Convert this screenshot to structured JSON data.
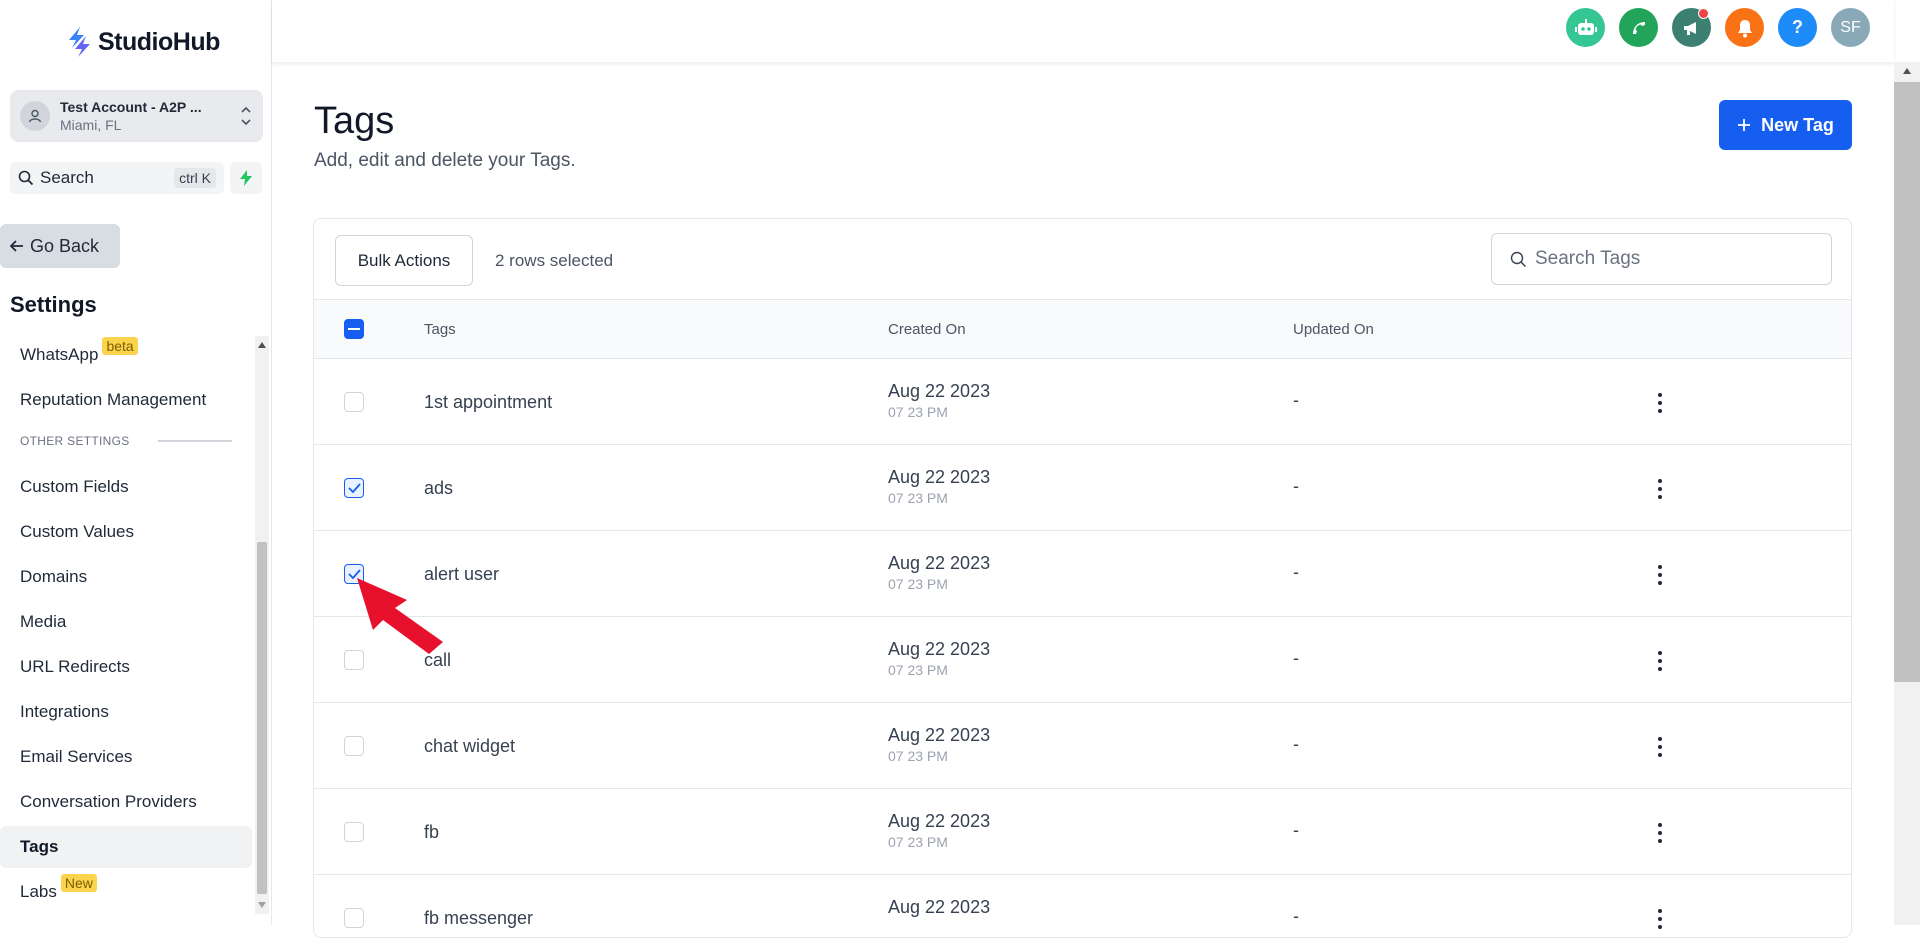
{
  "brand": {
    "name": "StudioHub"
  },
  "account": {
    "name": "Test Account - A2P ...",
    "location": "Miami, FL"
  },
  "sidebar_search": {
    "label": "Search",
    "shortcut": "ctrl K"
  },
  "go_back": {
    "label": "Go Back"
  },
  "settings_title": "Settings",
  "nav": {
    "section_label": "OTHER SETTINGS",
    "items": [
      {
        "label": "WhatsApp",
        "badge": "beta"
      },
      {
        "label": "Reputation Management"
      },
      {
        "label": "Custom Fields"
      },
      {
        "label": "Custom Values"
      },
      {
        "label": "Domains"
      },
      {
        "label": "Media"
      },
      {
        "label": "URL Redirects"
      },
      {
        "label": "Integrations"
      },
      {
        "label": "Email Services"
      },
      {
        "label": "Conversation Providers"
      },
      {
        "label": "Tags"
      },
      {
        "label": "Labs",
        "badge": "New"
      }
    ],
    "active": "Tags"
  },
  "topbar": {
    "icons": [
      {
        "name": "robot-icon",
        "color": "#34c793"
      },
      {
        "name": "phone-icon",
        "color": "#22a55b"
      },
      {
        "name": "megaphone-icon",
        "color": "#3b8071"
      },
      {
        "name": "bell-icon",
        "color": "#f97316"
      },
      {
        "name": "help-icon",
        "color": "#1d8cf8",
        "text": "?"
      },
      {
        "name": "user-avatar",
        "color": "#8aa9b8",
        "text": "SF"
      }
    ]
  },
  "page": {
    "title": "Tags",
    "subtitle": "Add, edit and delete your Tags.",
    "new_button": "New Tag"
  },
  "toolbar": {
    "bulk_actions": "Bulk Actions",
    "rows_selected": "2 rows selected",
    "search_placeholder": "Search Tags"
  },
  "table": {
    "columns": [
      "Tags",
      "Created On",
      "Updated On"
    ],
    "rows": [
      {
        "tag": "1st appointment",
        "date": "Aug 22 2023",
        "time": "07 23 PM",
        "updated": "-",
        "checked": false
      },
      {
        "tag": "ads",
        "date": "Aug 22 2023",
        "time": "07 23 PM",
        "updated": "-",
        "checked": true
      },
      {
        "tag": "alert user",
        "date": "Aug 22 2023",
        "time": "07 23 PM",
        "updated": "-",
        "checked": true
      },
      {
        "tag": "call",
        "date": "Aug 22 2023",
        "time": "07 23 PM",
        "updated": "-",
        "checked": false
      },
      {
        "tag": "chat widget",
        "date": "Aug 22 2023",
        "time": "07 23 PM",
        "updated": "-",
        "checked": false
      },
      {
        "tag": "fb",
        "date": "Aug 22 2023",
        "time": "07 23 PM",
        "updated": "-",
        "checked": false
      },
      {
        "tag": "fb messenger",
        "date": "Aug 22 2023",
        "time": "",
        "updated": "-",
        "checked": false
      }
    ]
  },
  "colors": {
    "primary": "#155eef",
    "annotation": "#e8112d"
  }
}
